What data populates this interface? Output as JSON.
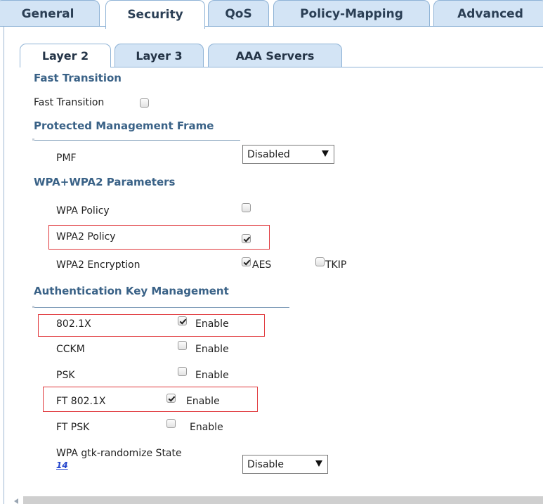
{
  "top_tabs": [
    {
      "label": "General"
    },
    {
      "label": "Security"
    },
    {
      "label": "QoS"
    },
    {
      "label": "Policy-Mapping"
    },
    {
      "label": "Advanced"
    }
  ],
  "sub_tabs": [
    {
      "label": "Layer 2"
    },
    {
      "label": "Layer 3"
    },
    {
      "label": "AAA Servers"
    }
  ],
  "fast_transition": {
    "heading": "Fast Transition",
    "label": "Fast Transition",
    "checked": false
  },
  "pmf": {
    "heading": "Protected Management Frame",
    "label": "PMF",
    "selected": "Disabled"
  },
  "wpa": {
    "heading": "WPA+WPA2 Parameters",
    "wpa_policy_label": "WPA Policy",
    "wpa_policy_checked": false,
    "wpa2_policy_label": "WPA2 Policy",
    "wpa2_policy_checked": true,
    "wpa2_encryption_label": "WPA2 Encryption",
    "aes_label": "AES",
    "aes_checked": true,
    "tkip_label": "TKIP",
    "tkip_checked": false
  },
  "akm": {
    "heading": "Authentication Key Management",
    "rows": [
      {
        "label": "802.1X",
        "enable_label": "Enable",
        "checked": true
      },
      {
        "label": "CCKM",
        "enable_label": "Enable",
        "checked": false
      },
      {
        "label": "PSK",
        "enable_label": "Enable",
        "checked": false
      },
      {
        "label": "FT 802.1X",
        "enable_label": "Enable",
        "checked": true
      },
      {
        "label": "FT PSK",
        "enable_label": "Enable",
        "checked": false
      }
    ],
    "gtk_label": "WPA gtk-randomize State",
    "gtk_footnote": "14",
    "gtk_selected": "Disable"
  },
  "colors": {
    "tab_inactive": "#d3e4f5",
    "section_heading": "#3a6287",
    "highlight": "#e0383c",
    "link": "#2244cc"
  }
}
